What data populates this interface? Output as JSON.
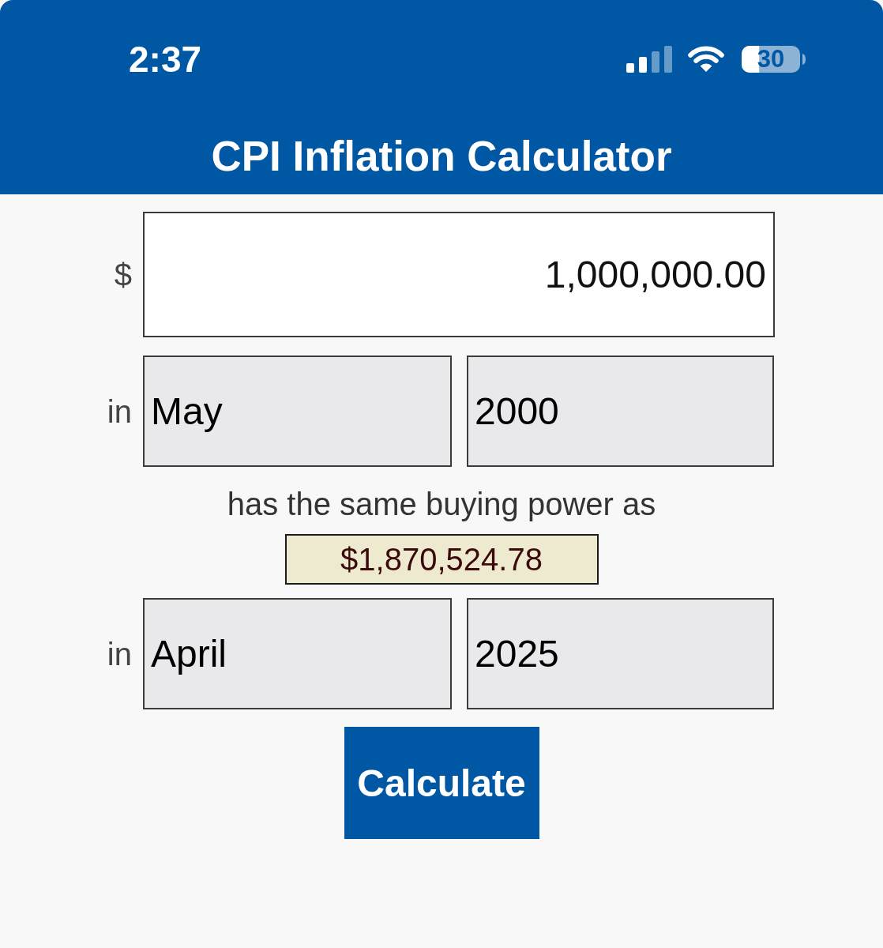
{
  "status_bar": {
    "time": "2:37",
    "battery": "30"
  },
  "header": {
    "title": "CPI Inflation Calculator"
  },
  "form": {
    "amount": {
      "label": "$",
      "value": "1,000,000.00"
    },
    "start": {
      "label": "in",
      "month": "May",
      "year": "2000"
    },
    "connector": "has the same buying power as",
    "result": "$1,870,524.78",
    "end": {
      "label": "in",
      "month": "April",
      "year": "2025"
    },
    "button": "Calculate"
  }
}
